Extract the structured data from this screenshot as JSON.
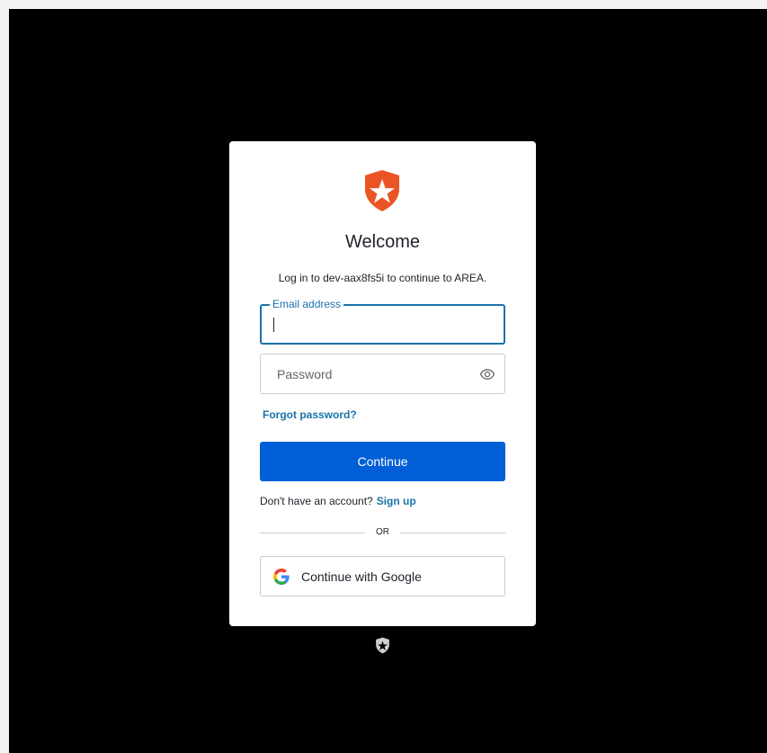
{
  "card": {
    "title": "Welcome",
    "subtitle": "Log in to dev-aax8fs5i to continue to AREA."
  },
  "email": {
    "label": "Email address",
    "value": ""
  },
  "password": {
    "placeholder": "Password",
    "toggle_icon": "eye-icon"
  },
  "links": {
    "forgot_password": "Forgot password?",
    "signup_prompt": "Don't have an account?",
    "signup": "Sign up"
  },
  "buttons": {
    "continue": "Continue",
    "google": "Continue with Google"
  },
  "divider": {
    "text": "OR"
  },
  "colors": {
    "brand_logo": "#eb5424",
    "primary_button": "#005fd6",
    "link": "#1a73a8",
    "background": "#000000"
  }
}
